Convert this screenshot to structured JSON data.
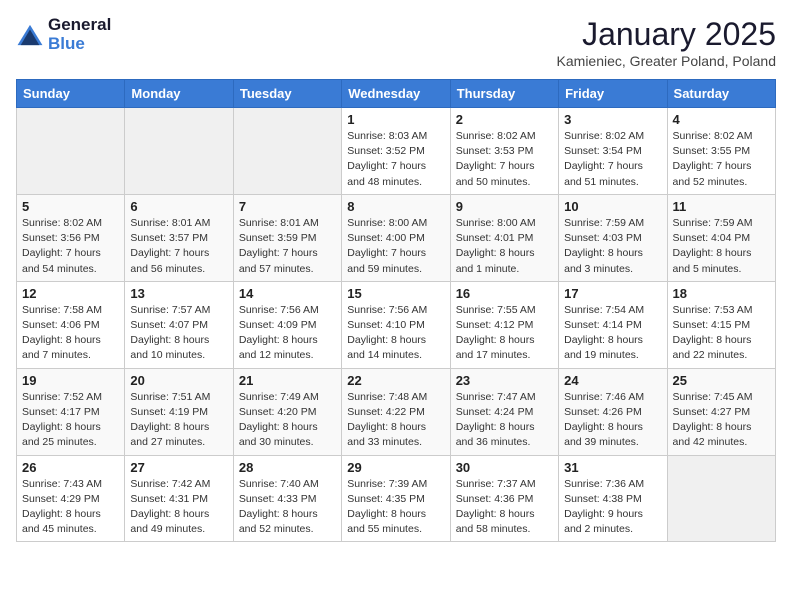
{
  "app": {
    "logo_general": "General",
    "logo_blue": "Blue"
  },
  "calendar": {
    "title": "January 2025",
    "subtitle": "Kamieniec, Greater Poland, Poland"
  },
  "days_of_week": [
    "Sunday",
    "Monday",
    "Tuesday",
    "Wednesday",
    "Thursday",
    "Friday",
    "Saturday"
  ],
  "weeks": [
    [
      {
        "day": "",
        "info": ""
      },
      {
        "day": "",
        "info": ""
      },
      {
        "day": "",
        "info": ""
      },
      {
        "day": "1",
        "info": "Sunrise: 8:03 AM\nSunset: 3:52 PM\nDaylight: 7 hours\nand 48 minutes."
      },
      {
        "day": "2",
        "info": "Sunrise: 8:02 AM\nSunset: 3:53 PM\nDaylight: 7 hours\nand 50 minutes."
      },
      {
        "day": "3",
        "info": "Sunrise: 8:02 AM\nSunset: 3:54 PM\nDaylight: 7 hours\nand 51 minutes."
      },
      {
        "day": "4",
        "info": "Sunrise: 8:02 AM\nSunset: 3:55 PM\nDaylight: 7 hours\nand 52 minutes."
      }
    ],
    [
      {
        "day": "5",
        "info": "Sunrise: 8:02 AM\nSunset: 3:56 PM\nDaylight: 7 hours\nand 54 minutes."
      },
      {
        "day": "6",
        "info": "Sunrise: 8:01 AM\nSunset: 3:57 PM\nDaylight: 7 hours\nand 56 minutes."
      },
      {
        "day": "7",
        "info": "Sunrise: 8:01 AM\nSunset: 3:59 PM\nDaylight: 7 hours\nand 57 minutes."
      },
      {
        "day": "8",
        "info": "Sunrise: 8:00 AM\nSunset: 4:00 PM\nDaylight: 7 hours\nand 59 minutes."
      },
      {
        "day": "9",
        "info": "Sunrise: 8:00 AM\nSunset: 4:01 PM\nDaylight: 8 hours\nand 1 minute."
      },
      {
        "day": "10",
        "info": "Sunrise: 7:59 AM\nSunset: 4:03 PM\nDaylight: 8 hours\nand 3 minutes."
      },
      {
        "day": "11",
        "info": "Sunrise: 7:59 AM\nSunset: 4:04 PM\nDaylight: 8 hours\nand 5 minutes."
      }
    ],
    [
      {
        "day": "12",
        "info": "Sunrise: 7:58 AM\nSunset: 4:06 PM\nDaylight: 8 hours\nand 7 minutes."
      },
      {
        "day": "13",
        "info": "Sunrise: 7:57 AM\nSunset: 4:07 PM\nDaylight: 8 hours\nand 10 minutes."
      },
      {
        "day": "14",
        "info": "Sunrise: 7:56 AM\nSunset: 4:09 PM\nDaylight: 8 hours\nand 12 minutes."
      },
      {
        "day": "15",
        "info": "Sunrise: 7:56 AM\nSunset: 4:10 PM\nDaylight: 8 hours\nand 14 minutes."
      },
      {
        "day": "16",
        "info": "Sunrise: 7:55 AM\nSunset: 4:12 PM\nDaylight: 8 hours\nand 17 minutes."
      },
      {
        "day": "17",
        "info": "Sunrise: 7:54 AM\nSunset: 4:14 PM\nDaylight: 8 hours\nand 19 minutes."
      },
      {
        "day": "18",
        "info": "Sunrise: 7:53 AM\nSunset: 4:15 PM\nDaylight: 8 hours\nand 22 minutes."
      }
    ],
    [
      {
        "day": "19",
        "info": "Sunrise: 7:52 AM\nSunset: 4:17 PM\nDaylight: 8 hours\nand 25 minutes."
      },
      {
        "day": "20",
        "info": "Sunrise: 7:51 AM\nSunset: 4:19 PM\nDaylight: 8 hours\nand 27 minutes."
      },
      {
        "day": "21",
        "info": "Sunrise: 7:49 AM\nSunset: 4:20 PM\nDaylight: 8 hours\nand 30 minutes."
      },
      {
        "day": "22",
        "info": "Sunrise: 7:48 AM\nSunset: 4:22 PM\nDaylight: 8 hours\nand 33 minutes."
      },
      {
        "day": "23",
        "info": "Sunrise: 7:47 AM\nSunset: 4:24 PM\nDaylight: 8 hours\nand 36 minutes."
      },
      {
        "day": "24",
        "info": "Sunrise: 7:46 AM\nSunset: 4:26 PM\nDaylight: 8 hours\nand 39 minutes."
      },
      {
        "day": "25",
        "info": "Sunrise: 7:45 AM\nSunset: 4:27 PM\nDaylight: 8 hours\nand 42 minutes."
      }
    ],
    [
      {
        "day": "26",
        "info": "Sunrise: 7:43 AM\nSunset: 4:29 PM\nDaylight: 8 hours\nand 45 minutes."
      },
      {
        "day": "27",
        "info": "Sunrise: 7:42 AM\nSunset: 4:31 PM\nDaylight: 8 hours\nand 49 minutes."
      },
      {
        "day": "28",
        "info": "Sunrise: 7:40 AM\nSunset: 4:33 PM\nDaylight: 8 hours\nand 52 minutes."
      },
      {
        "day": "29",
        "info": "Sunrise: 7:39 AM\nSunset: 4:35 PM\nDaylight: 8 hours\nand 55 minutes."
      },
      {
        "day": "30",
        "info": "Sunrise: 7:37 AM\nSunset: 4:36 PM\nDaylight: 8 hours\nand 58 minutes."
      },
      {
        "day": "31",
        "info": "Sunrise: 7:36 AM\nSunset: 4:38 PM\nDaylight: 9 hours\nand 2 minutes."
      },
      {
        "day": "",
        "info": ""
      }
    ]
  ]
}
